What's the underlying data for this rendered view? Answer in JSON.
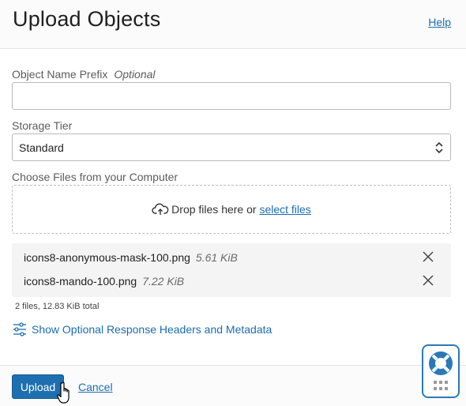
{
  "header": {
    "title": "Upload Objects",
    "help_label": "Help"
  },
  "form": {
    "prefix_label": "Object Name Prefix",
    "prefix_optional": "Optional",
    "prefix_value": "",
    "storage_tier_label": "Storage Tier",
    "storage_tier_value": "Standard",
    "choose_files_label": "Choose Files from your Computer",
    "drop_text": "Drop files here or",
    "select_files_label": "select files"
  },
  "files": [
    {
      "name": "icons8-anonymous-mask-100.png",
      "size": "5.61 KiB"
    },
    {
      "name": "icons8-mando-100.png",
      "size": "7.22 KiB"
    }
  ],
  "summary": "2 files, 12.83 KiB total",
  "optional_toggle_label": "Show Optional Response Headers and Metadata",
  "footer": {
    "upload_label": "Upload",
    "cancel_label": "Cancel"
  },
  "colors": {
    "accent": "#1d6fb0",
    "link": "#1a6db4"
  },
  "icons": {
    "cloud": "cloud-upload-icon",
    "remove": "close-icon",
    "settings": "sliders-icon",
    "help_widget": "lifebuoy-icon"
  }
}
